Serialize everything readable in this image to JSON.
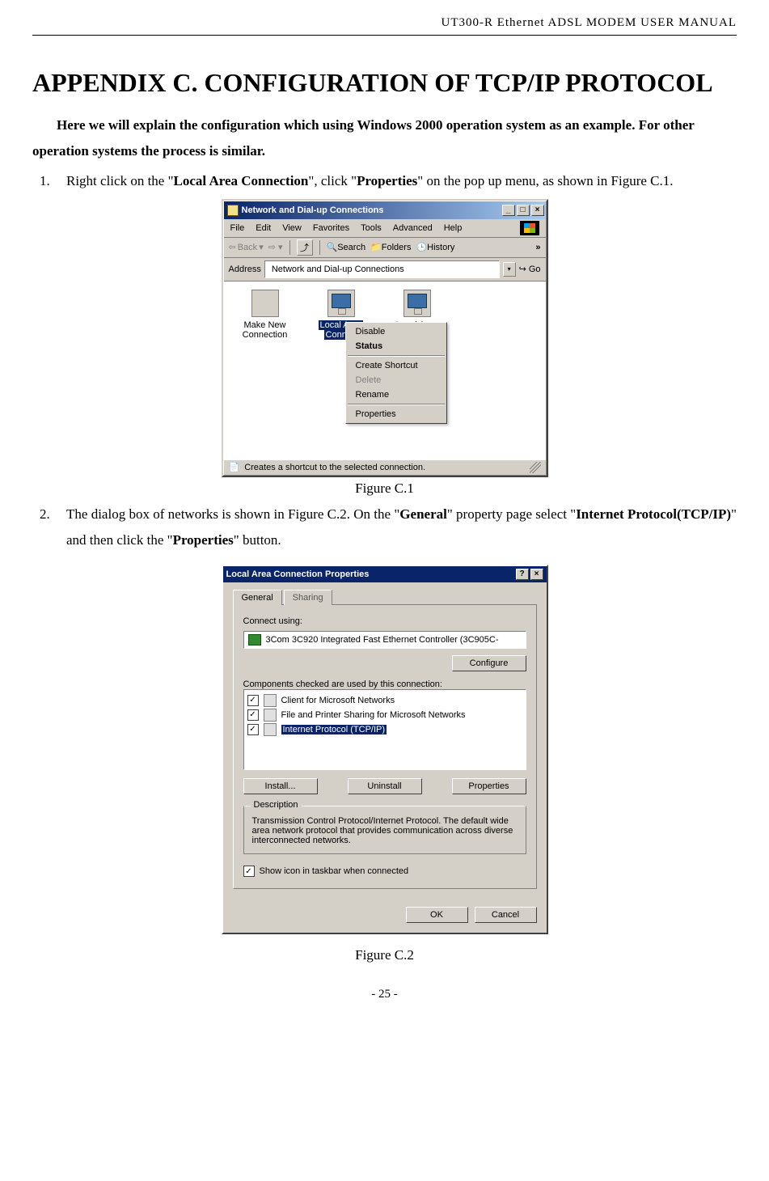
{
  "header": {
    "running": "UT300-R Ethernet ADSL MODEM USER MANUAL"
  },
  "title": "APPENDIX C. CONFIGURATION OF TCP/IP PROTOCOL",
  "intro": {
    "line1_full": "Here we will explain the configuration which using Windows 2000 operation system as an example. For other operation systems the process is similar."
  },
  "steps": {
    "s1": {
      "pre": "Right click on the \"",
      "b1": "Local Area Connection",
      "mid": "\", click \"",
      "b2": "Properties",
      "post": "\" on the pop up menu, as shown in Figure C.1."
    },
    "s2": {
      "pre": "The dialog box of networks is shown in Figure C.2. On the \"",
      "b1": "General",
      "mid1": "\" property page select \"",
      "b2": "Internet Protocol(TCP/IP)",
      "mid2": "\"   and then click the \"",
      "b3": "Properties",
      "post": "\" button."
    }
  },
  "fig1": {
    "caption": "Figure C.1",
    "window_title": "Network and Dial-up Connections",
    "menus": [
      "File",
      "Edit",
      "View",
      "Favorites",
      "Tools",
      "Advanced",
      "Help"
    ],
    "toolbar": {
      "back": "Back",
      "search": "Search",
      "folders": "Folders",
      "history": "History"
    },
    "address_label": "Address",
    "address_value": "Network and Dial-up Connections",
    "go": "Go",
    "items": {
      "make_new": "Make New Connection",
      "lac1_line1": "Local Area",
      "lac1_line2": "Connec",
      "lac2": "Local Area"
    },
    "context_menu": [
      "Disable",
      "Status",
      "Create Shortcut",
      "Delete",
      "Rename",
      "Properties"
    ],
    "statusbar": "Creates a shortcut to the selected connection."
  },
  "fig2": {
    "caption": "Figure C.2",
    "title": "Local Area Connection Properties",
    "tabs": {
      "general": "General",
      "sharing": "Sharing"
    },
    "connect_using_label": "Connect using:",
    "adapter": "3Com 3C920 Integrated Fast Ethernet Controller (3C905C-",
    "configure": "Configure",
    "components_label": "Components checked are used by this connection:",
    "components": [
      "Client for Microsoft Networks",
      "File and Printer Sharing for Microsoft Networks",
      "Internet Protocol (TCP/IP)"
    ],
    "buttons": {
      "install": "Install...",
      "uninstall": "Uninstall",
      "properties": "Properties"
    },
    "description_label": "Description",
    "description_text": "Transmission Control Protocol/Internet Protocol. The default wide area network protocol that provides communication across diverse interconnected networks.",
    "show_icon": "Show icon in taskbar when connected",
    "ok": "OK",
    "cancel": "Cancel"
  },
  "page_number": "- 25 -"
}
